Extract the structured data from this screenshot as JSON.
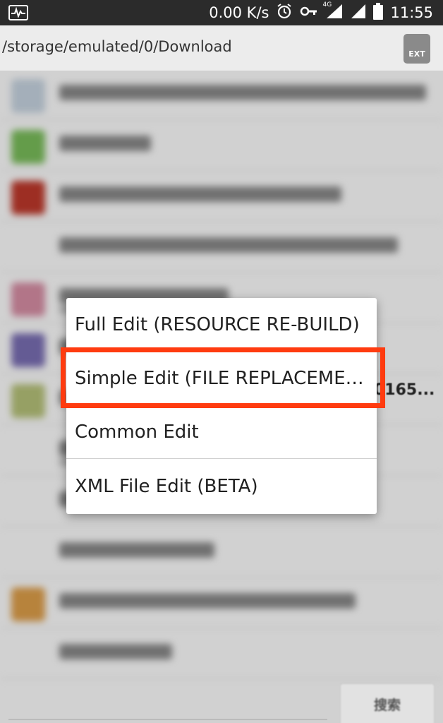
{
  "status_bar": {
    "speed": "0.00 K/s",
    "network": "4G",
    "time": "11:55"
  },
  "path_bar": {
    "path": "/storage/emulated/0/Download",
    "ext_label": "EXT"
  },
  "peek_text": "0165...",
  "menu": {
    "items": [
      {
        "label": "Full Edit (RESOURCE RE-BUILD)"
      },
      {
        "label": "Simple Edit (FILE REPLACEMENT)"
      },
      {
        "label": "Common Edit"
      },
      {
        "label": "XML File Edit (BETA)"
      }
    ],
    "highlight_color": "#ff3b0f"
  },
  "bottom_bar": {
    "search_label": "搜索"
  },
  "icons": [
    "activity-icon",
    "alarm-clock-icon",
    "key-icon",
    "signal-icon",
    "battery-icon",
    "sd-card-icon"
  ]
}
